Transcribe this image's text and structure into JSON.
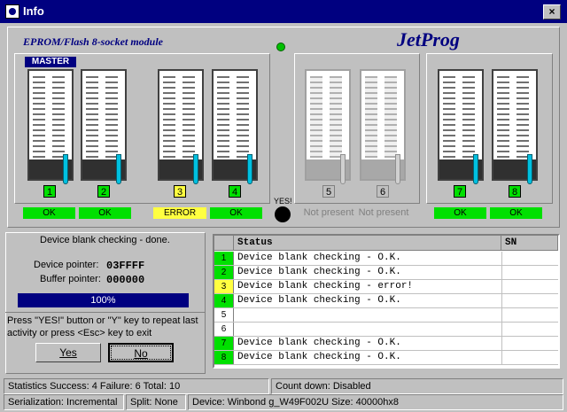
{
  "window": {
    "title": "Info",
    "close_glyph": "×"
  },
  "module_title": "EPROM/Flash 8-socket module",
  "brand": "JetProg",
  "master_label": "MASTER",
  "yes_button_label": "YES!",
  "sockets": [
    {
      "number": "1",
      "status": "OK",
      "state": "ok"
    },
    {
      "number": "2",
      "status": "OK",
      "state": "ok"
    },
    {
      "number": "3",
      "status": "ERROR",
      "state": "error"
    },
    {
      "number": "4",
      "status": "OK",
      "state": "ok"
    },
    {
      "number": "5",
      "status": "Not present",
      "state": "not-present"
    },
    {
      "number": "6",
      "status": "Not present",
      "state": "not-present"
    },
    {
      "number": "7",
      "status": "OK",
      "state": "ok"
    },
    {
      "number": "8",
      "status": "OK",
      "state": "ok"
    }
  ],
  "info": {
    "message": "Device blank checking - done.",
    "device_pointer_label": "Device pointer:",
    "device_pointer_value": "03FFFF",
    "buffer_pointer_label": "Buffer pointer:",
    "buffer_pointer_value": "000000",
    "progress_text": "100%",
    "progress": 1.0,
    "hint": "Press \"YES!\" button or \"Y\" key to repeat last activity or press <Esc> key to exit",
    "yes_label": "Yes",
    "no_label": "No"
  },
  "table": {
    "columns": [
      "",
      "Status",
      "SN"
    ],
    "rows": [
      {
        "num": "1",
        "status": "Device blank checking - O.K.",
        "sn": "",
        "state": "ok"
      },
      {
        "num": "2",
        "status": "Device blank checking - O.K.",
        "sn": "",
        "state": "ok"
      },
      {
        "num": "3",
        "status": "Device blank checking - error!",
        "sn": "",
        "state": "error"
      },
      {
        "num": "4",
        "status": "Device blank checking - O.K.",
        "sn": "",
        "state": "ok"
      },
      {
        "num": "5",
        "status": "",
        "sn": "",
        "state": "none"
      },
      {
        "num": "6",
        "status": "",
        "sn": "",
        "state": "none"
      },
      {
        "num": "7",
        "status": "Device blank checking - O.K.",
        "sn": "",
        "state": "ok"
      },
      {
        "num": "8",
        "status": "Device blank checking - O.K.",
        "sn": "",
        "state": "ok"
      }
    ]
  },
  "statusbar": {
    "statistics": "Statistics   Success: 4   Failure: 6   Total: 10",
    "countdown": "Count down: Disabled",
    "serialization": "Serialization: Incremental",
    "split": "Split: None",
    "device": "Device: Winbond g_W49F002U    Size: 40000hx8"
  },
  "colors": {
    "ok": "#00e000",
    "error": "#ffff40",
    "title": "#000080"
  }
}
